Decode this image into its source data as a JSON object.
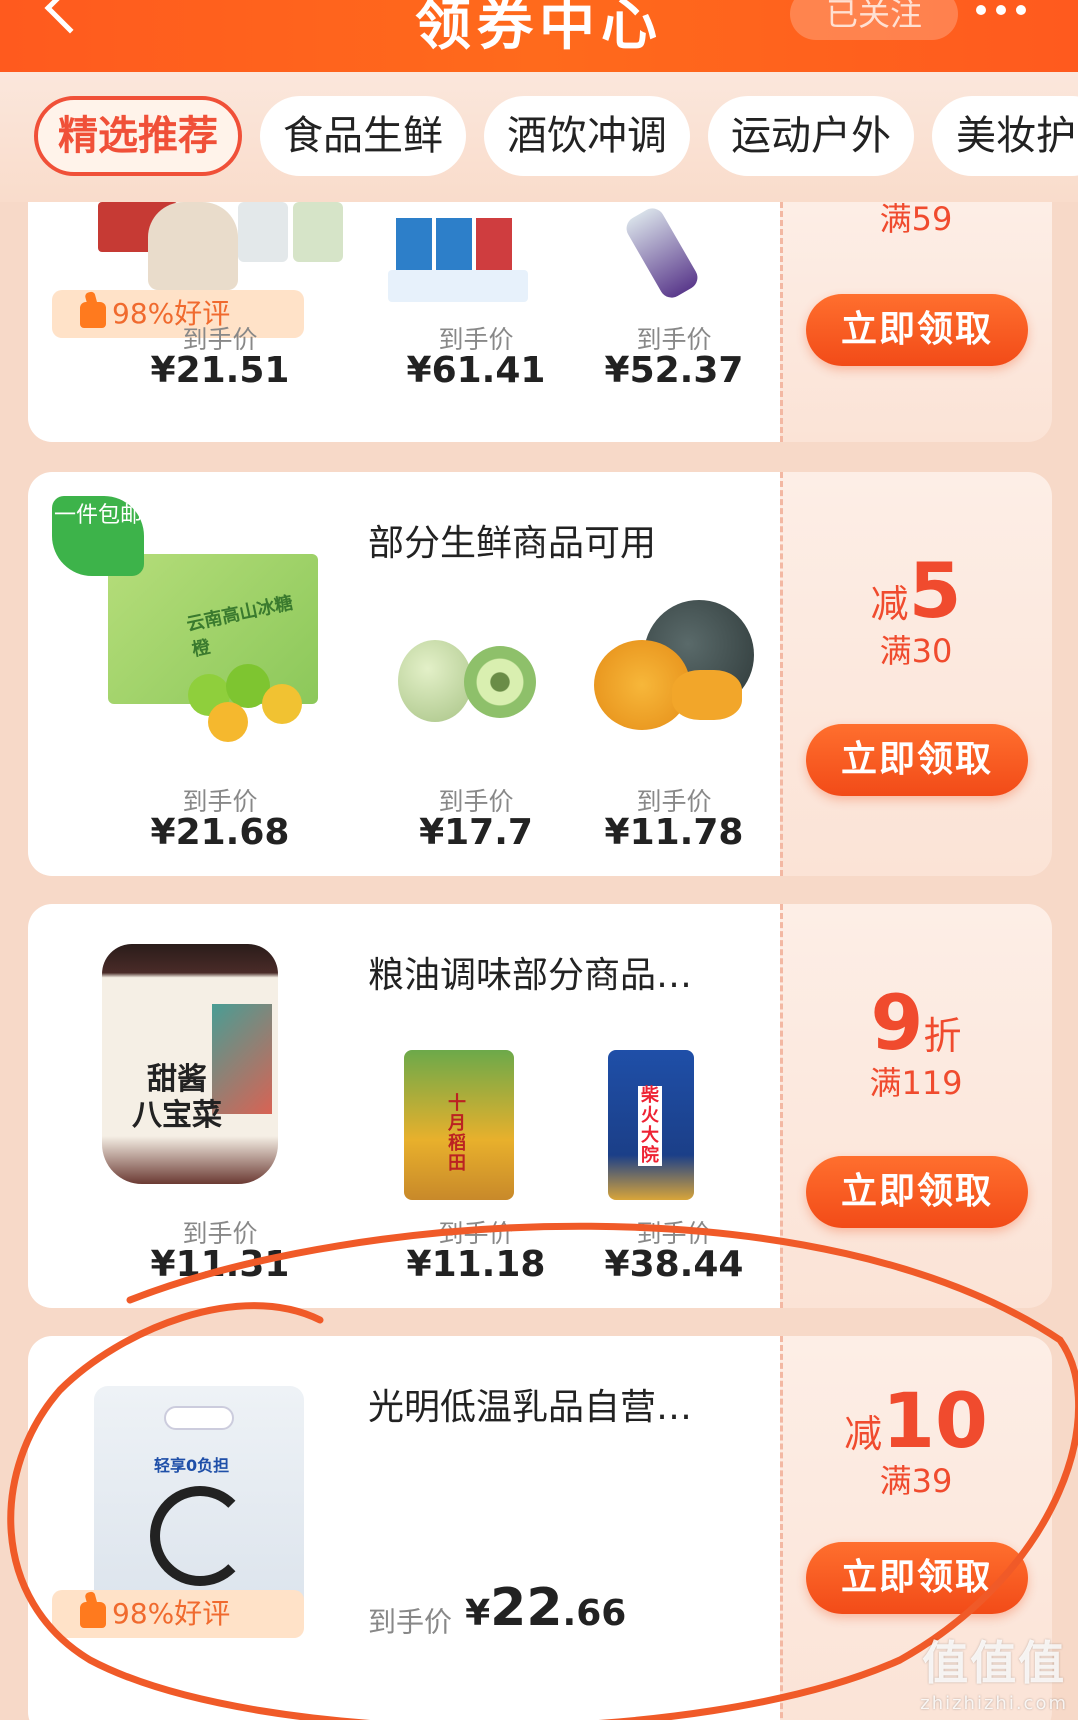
{
  "header": {
    "title": "领券中心",
    "follow_label": "已关注"
  },
  "tabs": [
    {
      "label": "精选推荐"
    },
    {
      "label": "食品生鲜"
    },
    {
      "label": "酒饮冲调"
    },
    {
      "label": "运动户外"
    },
    {
      "label": "美妆护"
    }
  ],
  "cards": [
    {
      "title": "",
      "deal_min": "满59",
      "claim_label": "立即领取",
      "good_rate": "98%好评",
      "products": [
        {
          "price_label": "到手价",
          "price": "¥21.51"
        },
        {
          "price_label": "到手价",
          "price": "¥61.41"
        },
        {
          "price_label": "到手价",
          "price": "¥52.37"
        }
      ]
    },
    {
      "title": "部分生鲜商品可用",
      "deal_prefix": "减",
      "deal_value": "5",
      "deal_min": "满30",
      "claim_label": "立即领取",
      "free_ship": "一件包邮",
      "product_box_text": "云南高山冰糖橙",
      "products": [
        {
          "price_label": "到手价",
          "price": "¥21.68"
        },
        {
          "price_label": "到手价",
          "price": "¥17.7"
        },
        {
          "price_label": "到手价",
          "price": "¥11.78"
        }
      ]
    },
    {
      "title": "粮油调味部分商品…",
      "deal_value": "9",
      "deal_suffix": "折",
      "deal_min": "满119",
      "claim_label": "立即领取",
      "jar_text_1": "甜酱",
      "jar_text_2": "八宝菜",
      "rice_text_1": "十月稻田",
      "rice_text_2": "柴火大院",
      "products": [
        {
          "price_label": "到手价",
          "price": "¥11.31"
        },
        {
          "price_label": "到手价",
          "price": "¥11.18"
        },
        {
          "price_label": "到手价",
          "price": "¥38.44"
        }
      ]
    },
    {
      "title": "光明低温乳品自营…",
      "deal_prefix": "减",
      "deal_value": "10",
      "deal_min": "满39",
      "claim_label": "立即领取",
      "good_rate": "98%好评",
      "bag_text": "轻享0负担",
      "price_label": "到手价",
      "price_symbol": "¥",
      "price_int": "22",
      "price_dec": ".66"
    }
  ],
  "watermark": {
    "big": "值值值",
    "small": "zhizhizhi.com"
  }
}
